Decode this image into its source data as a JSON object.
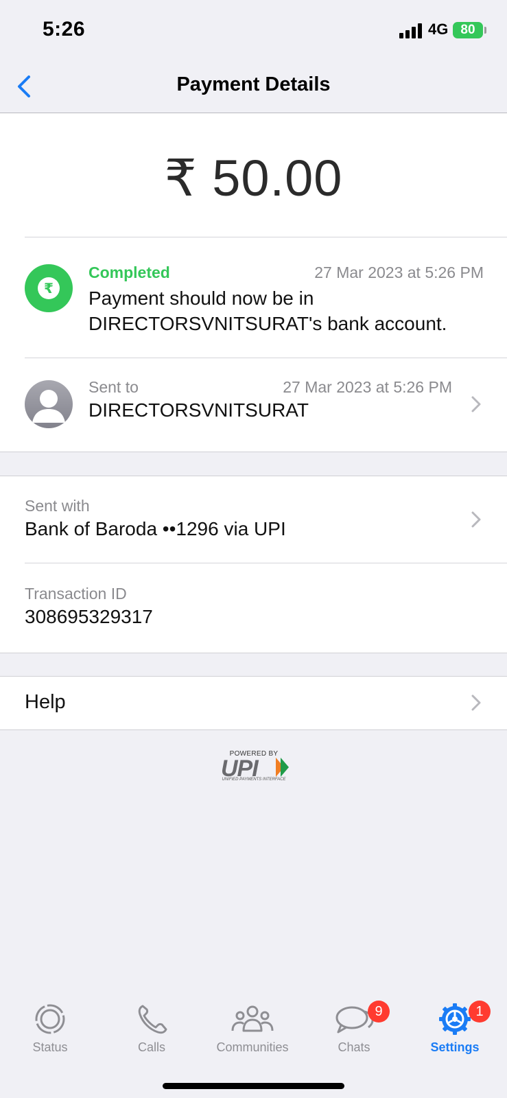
{
  "status_bar": {
    "time": "5:26",
    "network": "4G",
    "battery": "80"
  },
  "nav": {
    "title": "Payment Details",
    "back_icon": "chevron-left-icon"
  },
  "payment": {
    "amount": "₹ 50.00",
    "status": {
      "label": "Completed",
      "time": "27 Mar 2023 at 5:26 PM",
      "message": "Payment should now be in DIRECTORSVNITSURAT's bank account.",
      "icon": "rupee-icon",
      "color": "#34c759"
    },
    "recipient": {
      "label": "Sent to",
      "time": "27 Mar 2023 at 5:26 PM",
      "name": "DIRECTORSVNITSURAT"
    }
  },
  "details": {
    "sent_with": {
      "label": "Sent with",
      "value": "Bank of Baroda ••1296 via UPI"
    },
    "transaction": {
      "label": "Transaction ID",
      "value": "308695329317"
    }
  },
  "help": {
    "label": "Help"
  },
  "upi_logo": {
    "powered_by": "POWERED BY",
    "text": "UPI",
    "subtitle": "UNIFIED PAYMENTS INTERFACE"
  },
  "tabs": [
    {
      "label": "Status",
      "icon": "status-icon",
      "badge": ""
    },
    {
      "label": "Calls",
      "icon": "phone-icon",
      "badge": ""
    },
    {
      "label": "Communities",
      "icon": "communities-icon",
      "badge": ""
    },
    {
      "label": "Chats",
      "icon": "chat-icon",
      "badge": "9"
    },
    {
      "label": "Settings",
      "icon": "gear-icon",
      "badge": "1",
      "active": true
    }
  ],
  "colors": {
    "accent": "#1a7cf5",
    "success": "#34c759",
    "badge": "#ff3b30"
  }
}
